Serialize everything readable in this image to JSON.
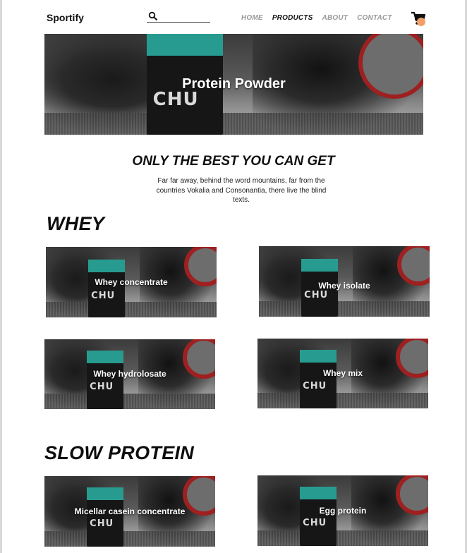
{
  "brand": "Sportify",
  "search": {
    "placeholder": ""
  },
  "nav": [
    {
      "label": "HOME",
      "active": false
    },
    {
      "label": "PRODUCTS",
      "active": true
    },
    {
      "label": "ABOUT",
      "active": false
    },
    {
      "label": "CONTACT",
      "active": false
    }
  ],
  "icons": {
    "search": "search-icon",
    "cart": "cart-icon",
    "cart_badge_color": "#f2a06a"
  },
  "hero": {
    "title": "Protein Powder",
    "bag_text": "CHU"
  },
  "intro": {
    "heading": "ONLY THE BEST YOU CAN GET",
    "text": "Far far away, behind the word mountains, far from the countries Vokalia and Consonantia, there live the blind texts."
  },
  "sections": [
    {
      "title": "WHEY",
      "products": [
        {
          "label": "Whey concentrate"
        },
        {
          "label": "Whey isolate"
        },
        {
          "label": "Whey hydrolosate"
        },
        {
          "label": "Whey mix"
        }
      ]
    },
    {
      "title": "SLOW PROTEIN",
      "products": [
        {
          "label": "Micellar casein concentrate"
        },
        {
          "label": "Egg protein"
        }
      ]
    }
  ]
}
